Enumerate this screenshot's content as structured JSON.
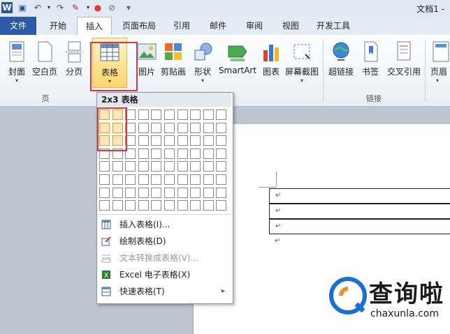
{
  "window": {
    "title": "文档1 -"
  },
  "quick_access": {
    "icons": [
      "word-icon",
      "save-icon",
      "undo-icon",
      "redo-icon",
      "format-painter-icon",
      "color-icon",
      "clear-format-icon",
      "customize-icon"
    ]
  },
  "tabs": [
    "文件",
    "开始",
    "插入",
    "页面布局",
    "引用",
    "邮件",
    "审阅",
    "视图",
    "开发工具"
  ],
  "ribbon": {
    "buttons": [
      {
        "label": "封面",
        "arrow": "▾"
      },
      {
        "label": "空白页"
      },
      {
        "label": "分页"
      },
      {
        "label": "表格",
        "arrow": "▾"
      },
      {
        "label": "图片"
      },
      {
        "label": "剪贴画"
      },
      {
        "label": "形状",
        "arrow": "▾"
      },
      {
        "label": "SmartArt"
      },
      {
        "label": "图表"
      },
      {
        "label": "屏幕截图",
        "arrow": "▾"
      },
      {
        "label": "超链接"
      },
      {
        "label": "书签"
      },
      {
        "label": "交叉引用"
      },
      {
        "label": "页眉",
        "arrow": "▾"
      }
    ],
    "groups": [
      "页",
      "链接"
    ]
  },
  "menu": {
    "header": "2x3 表格",
    "grid": {
      "cols": 10,
      "rows": 8,
      "selected_cols": 2,
      "selected_rows": 3
    },
    "items": [
      {
        "label": "插入表格(I)...",
        "enabled": true
      },
      {
        "label": "绘制表格(D)",
        "enabled": true
      },
      {
        "label": "文本转换成表格(V)...",
        "enabled": false
      },
      {
        "label": "Excel 电子表格(X)",
        "enabled": true
      },
      {
        "label": "快速表格(T)",
        "enabled": true,
        "submenu": "▸"
      }
    ]
  },
  "document": {
    "para_mark": "↵"
  },
  "watermark": {
    "brand": "查询啦",
    "url": "chaxunla.com",
    "color": "#1a6fd1"
  },
  "colors": {
    "file_tab": "#2a5aa8",
    "highlight_box": "#d9373a",
    "grid_selected": "#fde7b9"
  }
}
